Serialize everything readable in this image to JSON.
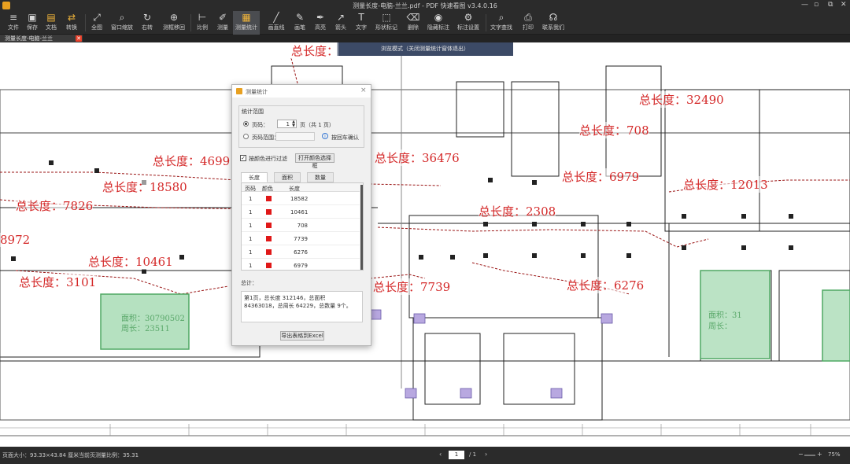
{
  "app": {
    "title": "测量长度-电脑-兰兰.pdf - PDF 快速看图 v3.4.0.16",
    "window_controls": [
      "—",
      "▫",
      "⧉",
      "✕"
    ]
  },
  "toolbar": {
    "items": [
      {
        "label": "文件",
        "icon": "≡"
      },
      {
        "label": "保存",
        "icon": "▣"
      },
      {
        "label": "文档",
        "icon": "▤"
      },
      {
        "label": "转换",
        "icon": "⇄"
      },
      {
        "label": "全图",
        "icon": "⤢"
      },
      {
        "label": "窗口缩放",
        "icon": "⌕"
      },
      {
        "label": "右转",
        "icon": "↻"
      },
      {
        "label": "测框移回",
        "icon": "⊕"
      },
      {
        "label": "比例",
        "icon": "⊢"
      },
      {
        "label": "测量",
        "icon": "✐"
      },
      {
        "label": "测量统计",
        "icon": "▦"
      },
      {
        "label": "画直线",
        "icon": "╱"
      },
      {
        "label": "画笔",
        "icon": "✎"
      },
      {
        "label": "高亮",
        "icon": "✒"
      },
      {
        "label": "箭头",
        "icon": "↗"
      },
      {
        "label": "文字",
        "icon": "T"
      },
      {
        "label": "形状标记",
        "icon": "⬚"
      },
      {
        "label": "删除",
        "icon": "⌫"
      },
      {
        "label": "隐藏标注",
        "icon": "◉"
      },
      {
        "label": "标注设置",
        "icon": "⚙"
      },
      {
        "label": "文字查找",
        "icon": "⌕"
      },
      {
        "label": "打印",
        "icon": "⎙"
      },
      {
        "label": "联系我们",
        "icon": "☊"
      }
    ]
  },
  "tab": {
    "label": "测量长度-电脑-兰兰",
    "close": "✕"
  },
  "canvas": {
    "banner": "浏览模式（关闭测量统计窗体退出）",
    "length_marks": [
      {
        "text": "总长度：4699"
      },
      {
        "text": "总长度：18580"
      },
      {
        "text": "总长度：7826"
      },
      {
        "text": "8972"
      },
      {
        "text": "总长度：10461"
      },
      {
        "text": "总长度：3101"
      },
      {
        "text": "总长度：36476"
      },
      {
        "text": "总长度：708"
      },
      {
        "text": "总长度：6979"
      },
      {
        "text": "总长度：2308"
      },
      {
        "text": "总长度：7739"
      },
      {
        "text": "总长度：6276"
      },
      {
        "text": "总长度：32490"
      },
      {
        "text": "总长度：12013"
      },
      {
        "text": "总长度："
      }
    ],
    "area_marks": [
      {
        "text": "面积：30790502"
      },
      {
        "text": "周长：23511"
      },
      {
        "text": "面积：31"
      },
      {
        "text": "周长："
      }
    ]
  },
  "dialog": {
    "title": "测量统计",
    "close": "×",
    "range_group": "统计范围",
    "page_radio_label": "页码：",
    "page_value": "1",
    "page_suffix": "页（共 1 页）",
    "range_radio_label": "页码范围：",
    "enter_hint": "按回车确认",
    "filter_checkbox": "按颜色进行过滤",
    "color_button": "打开颜色选择框",
    "tabs": [
      "长度",
      "面积",
      "数量"
    ],
    "columns": [
      "页码",
      "颜色",
      "长度"
    ],
    "rows": [
      {
        "page": "1",
        "length": "18582"
      },
      {
        "page": "1",
        "length": "10461"
      },
      {
        "page": "1",
        "length": "708"
      },
      {
        "page": "1",
        "length": "7739"
      },
      {
        "page": "1",
        "length": "6276"
      },
      {
        "page": "1",
        "length": "6979"
      }
    ],
    "total_label": "总计：",
    "summary": "第1页，总长度 312146，总面积 84363018，总周长 64229，总数量 9个。",
    "export_button": "导出表格到Excel"
  },
  "status": {
    "page_size": "页面大小：93.33×43.84 厘米",
    "scale": "当前页测量比例：35.31",
    "page_current": "1",
    "page_total": "/ 1",
    "zoom": "75%"
  },
  "colors": {
    "mark_red": "#d42828",
    "area_green": "#5aa86a",
    "accent_orange": "#e8a020"
  }
}
